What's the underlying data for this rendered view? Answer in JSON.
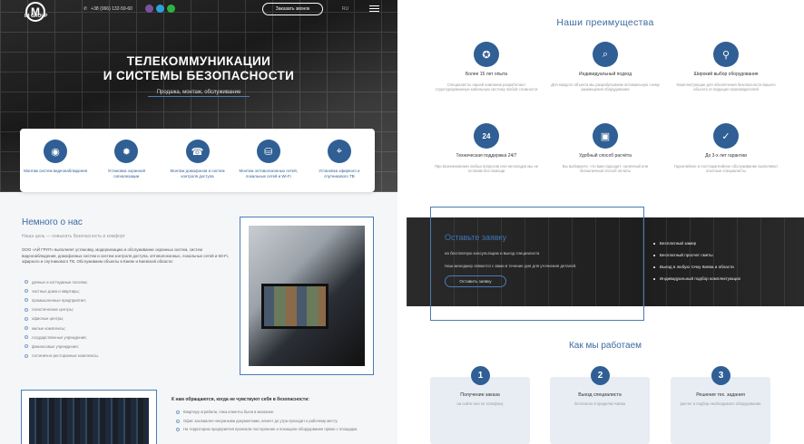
{
  "header": {
    "logo_letter": "M",
    "logo_text": "IM GROUP",
    "phone": "+38 (066) 132-59-60",
    "call_button": "Заказать звонок",
    "lang": "RU"
  },
  "hero": {
    "title_line1": "ТЕЛЕКОММУНИКАЦИИ",
    "title_line2": "И СИСТЕМЫ БЕЗОПАСНОСТИ",
    "subtitle": "Продажа, монтаж, обслуживание"
  },
  "services": [
    {
      "icon": "cctv-camera-icon",
      "glyph": "◉",
      "label": "Монтаж систем видеонаблюдения"
    },
    {
      "icon": "alarm-icon",
      "glyph": "✹",
      "label": "Установка охранной сигнализации"
    },
    {
      "icon": "intercom-icon",
      "glyph": "☎",
      "label": "Монтаж домофонов и систем контроля доступа"
    },
    {
      "icon": "network-icon",
      "glyph": "⛁",
      "label": "Монтаж оптоволоконных сетей, локальных сетей и Wi-Fi"
    },
    {
      "icon": "satellite-icon",
      "glyph": "⌖",
      "label": "Установка эфирного и спутникового ТВ"
    }
  ],
  "about": {
    "heading": "Немного о нас",
    "subheading": "Наша цель — повысить безопасность и комфорт",
    "text": "ООО «АЙ ГРУП» выполняет установку, модернизацию и обслуживание охранных систем, систем видеонаблюдения, домофонных систем и систем контроля доступа, оптоволоконных, локальных сетей и Wi-Fi, эфирного и спутникового ТВ. Обслуживаем объекты в Киеве и Киевской области:",
    "list": [
      "дачные и коттеджные поселки;",
      "частные дома и квартиры;",
      "промышленные предприятия;",
      "логистические центры;",
      "офисные центры;",
      "жилые комплексы;",
      "государственные учреждения;",
      "финансовые учреждения;",
      "гостинично-ресторанные комплексы."
    ]
  },
  "questions": {
    "heading": "К нам обращаются, когда не чувствуют себя в безопасности:",
    "list": [
      "Квартиру ограбили, пока клиенты были в магазине.",
      "Офис захламлен ненужными документами, клиент до утра проходит к рабочему месту.",
      "На территорию предприятия проникли посторонние и похищали оборудование прямо с площадки."
    ]
  },
  "advantages": {
    "heading": "Наши преимущества",
    "items": [
      {
        "icon": "award-icon",
        "glyph": "✪",
        "title": "Более 15 лет опыта",
        "desc": "Специалисты нашей компании разработают структурированную кабельную систему любой сложности"
      },
      {
        "icon": "document-search-icon",
        "glyph": "⌕",
        "title": "Индивидуальный подход",
        "desc": "Для каждого объекта мы разрабатываем оптимальную схему размещения оборудования"
      },
      {
        "icon": "satellite-dish-icon",
        "glyph": "⚲",
        "title": "Широкий выбор оборудования",
        "desc": "Комплектующие для обеспечения безопасности вашего объекта от ведущих производителей"
      },
      {
        "icon": "support-24-icon",
        "glyph": "24",
        "title": "Техническая поддержка 24/7",
        "desc": "При возникновении любых вопросов или неполадок мы не оставим без помощи"
      },
      {
        "icon": "wallet-icon",
        "glyph": "▣",
        "title": "Удобный способ расчёта",
        "desc": "Вы выбираете, что вам подходит: наличный или безналичный способ оплаты"
      },
      {
        "icon": "shield-check-icon",
        "glyph": "✓",
        "title": "До 3-х лет гарантии",
        "desc": "Гарантийное и постгарантийное обслуживание выполняют опытные специалисты"
      }
    ]
  },
  "request": {
    "heading": "Оставьте заявку",
    "text1": "на бесплатную консультацию и выезд специалиста",
    "text2": "Наш менеджер свяжется с вами в течение дня для уточнения деталей.",
    "button": "Оставить заявку",
    "list": [
      "Бесплатный замер",
      "Бесплатный просчет сметы",
      "Выезд в любую точку Киева и области",
      "Индивидуальный подбор комплектующих"
    ]
  },
  "how": {
    "heading": "Как мы работаем",
    "steps": [
      {
        "num": "1",
        "title": "Получение заказа",
        "desc": "на сайте или по телефону"
      },
      {
        "num": "2",
        "title": "Выезд специалиста",
        "desc": "бесплатно в пределах Киева"
      },
      {
        "num": "3",
        "title": "Решение тех. задания",
        "desc": "расчет и подбор необходимого оборудования"
      }
    ]
  }
}
